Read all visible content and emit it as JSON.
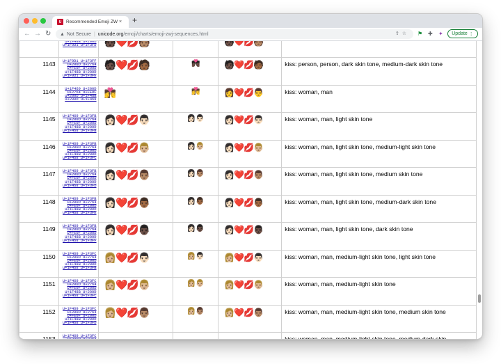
{
  "browser": {
    "tab_title": "Recommended Emoji ZWJ Sequ",
    "tab_favicon": "U",
    "tab_close": "×",
    "new_tab": "+",
    "not_secure": "Not Secure",
    "url_host": "unicode.org",
    "url_path": "/emoji/charts/emoji-zwj-sequences.html",
    "update_label": "Update",
    "icons": [
      "back-arrow-icon",
      "forward-arrow-icon",
      "reload-icon",
      "warning-icon",
      "share-icon",
      "bookmark-star-icon",
      "extension-flag-icon",
      "puzzle-icon",
      "profile-icon",
      "kebab-menu-icon"
    ]
  },
  "rows": [
    {
      "num": "",
      "codes": [
        "U+FE0F U+200D",
        "U+1F48B U+200D",
        "U+1F9D1 U+1F3FD"
      ],
      "browser": "🧑🏿❤️💋🧑🏽",
      "sample": "",
      "other": "🧑🏿❤️💋🧑🏽",
      "name": ""
    },
    {
      "num": "1143",
      "codes": [
        "U+1F9D1 U+1F3FF",
        "U+200D U+2764",
        "U+FE0F U+200D",
        "U+1F48B U+200D",
        "U+1F9D1 U+1F3FE"
      ],
      "browser": "🧑🏿❤️💋🧑🏾",
      "sample": "💏🏿",
      "other": "🧑🏿❤️💋🧑🏾",
      "name": "kiss: person, person, dark skin tone, medium-dark skin tone"
    },
    {
      "num": "1144",
      "codes": [
        "U+1F469 U+200D",
        "U+2764 U+FE0F",
        "U+200D U+1F48B",
        "U+200D U+1F468"
      ],
      "browser": "👩‍❤️‍💋‍👨",
      "sample": "👩‍❤️‍💋‍👨",
      "other": "👩❤️💋👨",
      "name": "kiss: woman, man"
    },
    {
      "num": "1145",
      "codes": [
        "U+1F469 U+1F3FB",
        "U+200D U+2764",
        "U+FE0F U+200D",
        "U+1F48B U+200D",
        "U+1F468 U+1F3FB"
      ],
      "browser": "👩🏻❤️💋👨🏻",
      "sample": "👩🏻👨🏻",
      "other": "👩🏻❤️💋👨🏻",
      "name": "kiss: woman, man, light skin tone"
    },
    {
      "num": "1146",
      "codes": [
        "U+1F469 U+1F3FB",
        "U+200D U+2764",
        "U+FE0F U+200D",
        "U+1F48B U+200D",
        "U+1F468 U+1F3FC"
      ],
      "browser": "👩🏻❤️💋👨🏼",
      "sample": "👩🏻👨🏼",
      "other": "👩🏻❤️💋👨🏼",
      "name": "kiss: woman, man, light skin tone, medium-light skin tone"
    },
    {
      "num": "1147",
      "codes": [
        "U+1F469 U+1F3FB",
        "U+200D U+2764",
        "U+FE0F U+200D",
        "U+1F48B U+200D",
        "U+1F468 U+1F3FD"
      ],
      "browser": "👩🏻❤️💋👨🏽",
      "sample": "👩🏻👨🏽",
      "other": "👩🏻❤️💋👨🏽",
      "name": "kiss: woman, man, light skin tone, medium skin tone"
    },
    {
      "num": "1148",
      "codes": [
        "U+1F469 U+1F3FB",
        "U+200D U+2764",
        "U+FE0F U+200D",
        "U+1F48B U+200D",
        "U+1F468 U+1F3FE"
      ],
      "browser": "👩🏻❤️💋👨🏾",
      "sample": "👩🏻👨🏾",
      "other": "👩🏻❤️💋👨🏾",
      "name": "kiss: woman, man, light skin tone, medium-dark skin tone"
    },
    {
      "num": "1149",
      "codes": [
        "U+1F469 U+1F3FB",
        "U+200D U+2764",
        "U+FE0F U+200D",
        "U+1F48B U+200D",
        "U+1F468 U+1F3FF"
      ],
      "browser": "👩🏻❤️💋👨🏿",
      "sample": "👩🏻👨🏿",
      "other": "👩🏻❤️💋👨🏿",
      "name": "kiss: woman, man, light skin tone, dark skin tone"
    },
    {
      "num": "1150",
      "codes": [
        "U+1F469 U+1F3FC",
        "U+200D U+2764",
        "U+FE0F U+200D",
        "U+1F48B U+200D",
        "U+1F468 U+1F3FB"
      ],
      "browser": "👩🏼❤️💋👨🏻",
      "sample": "👩🏼👨🏻",
      "other": "👩🏼❤️💋👨🏻",
      "name": "kiss: woman, man, medium-light skin tone, light skin tone"
    },
    {
      "num": "1151",
      "codes": [
        "U+1F469 U+1F3FC",
        "U+200D U+2764",
        "U+FE0F U+200D",
        "U+1F48B U+200D",
        "U+1F468 U+1F3FC"
      ],
      "browser": "👩🏼❤️💋👨🏼",
      "sample": "👩🏼👨🏼",
      "other": "👩🏼❤️💋👨🏼",
      "name": "kiss: woman, man, medium-light skin tone"
    },
    {
      "num": "1152",
      "codes": [
        "U+1F469 U+1F3FC",
        "U+200D U+2764",
        "U+FE0F U+200D",
        "U+1F48B U+200D",
        "U+1F468 U+1F3FD"
      ],
      "browser": "👩🏼❤️💋👨🏽",
      "sample": "👩🏼👨🏽",
      "other": "👩🏼❤️💋👨🏽",
      "name": "kiss: woman, man, medium-light skin tone, medium skin tone"
    },
    {
      "num": "1153",
      "codes": [
        "U+1F469 U+1F3FC",
        "U+200D U+2764"
      ],
      "browser": "",
      "sample": "",
      "other": "",
      "name": "kiss: woman, man, medium-light skin tone, medium-dark skin"
    }
  ]
}
